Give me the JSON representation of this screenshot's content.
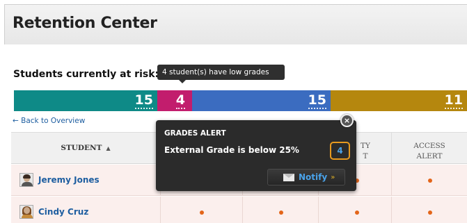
{
  "header": {
    "title": "Retention Center"
  },
  "risk": {
    "heading": "Students currently at risk:",
    "tooltip": "4 student(s) have low grades",
    "segments": [
      {
        "value": "15",
        "color": "#0e8a87"
      },
      {
        "value": "4",
        "color": "#c21d6d"
      },
      {
        "value": "15",
        "color": "#3b6cc0"
      },
      {
        "value": "11",
        "color": "#b5870e"
      }
    ]
  },
  "nav": {
    "back_link": "← Back to Overview"
  },
  "table": {
    "headers": {
      "student": "STUDENT",
      "col4_line1": "ACCESS",
      "col4_line2": "ALERT",
      "col3_partial_line1": "TY",
      "col3_partial_line2": "T"
    },
    "rows": [
      {
        "name": "Jeremy Jones"
      },
      {
        "name": "Cindy Cruz"
      }
    ]
  },
  "popup": {
    "title": "GRADES ALERT",
    "text": "External Grade is below 25%",
    "count": "4",
    "notify_label": "Notify",
    "close_symbol": "×"
  }
}
